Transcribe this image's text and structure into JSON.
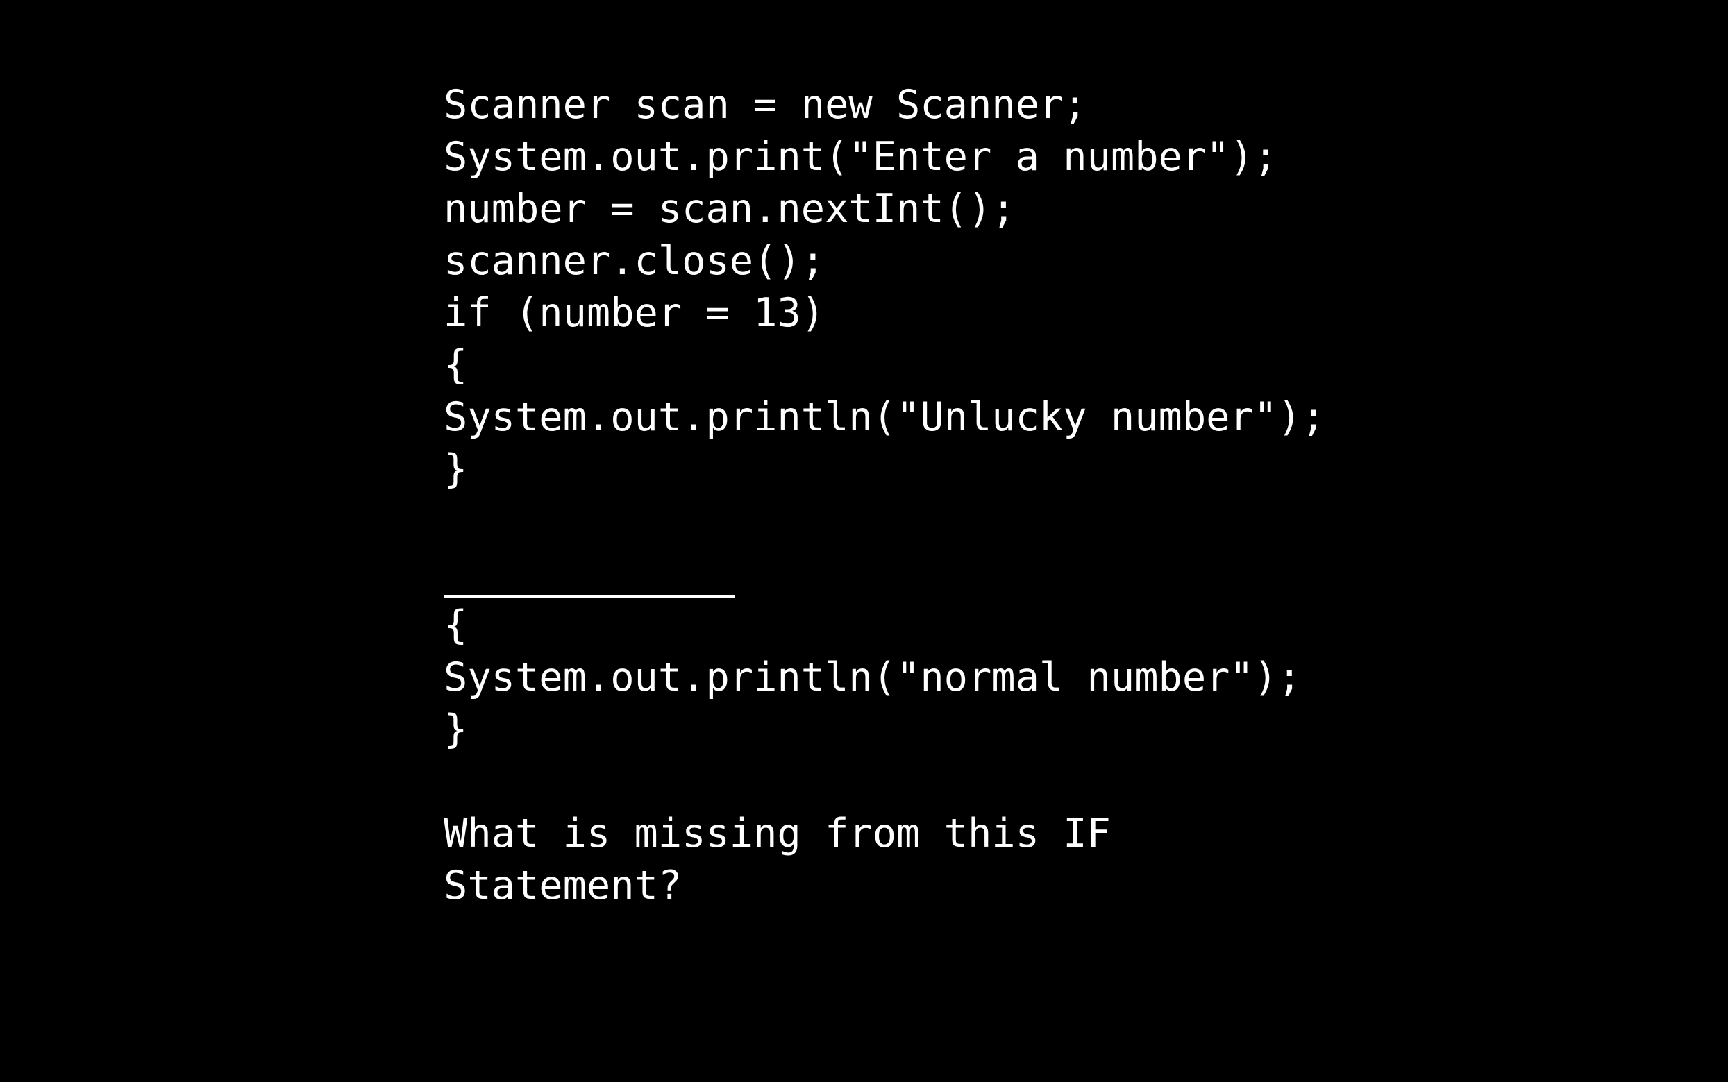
{
  "code": {
    "block_one": [
      "Scanner scan = new Scanner;",
      "System.out.print(\"Enter a number\");",
      "number = scan.nextInt();",
      "scanner.close();",
      "if (number = 13)",
      "{",
      "System.out.println(\"Unlucky number\");",
      "}"
    ],
    "block_two": [
      "{",
      "System.out.println(\"normal number\");",
      "}"
    ]
  },
  "question": {
    "text": "What is missing from this IF Statement?"
  },
  "colors": {
    "background": "#000000",
    "text": "#ffffff"
  }
}
